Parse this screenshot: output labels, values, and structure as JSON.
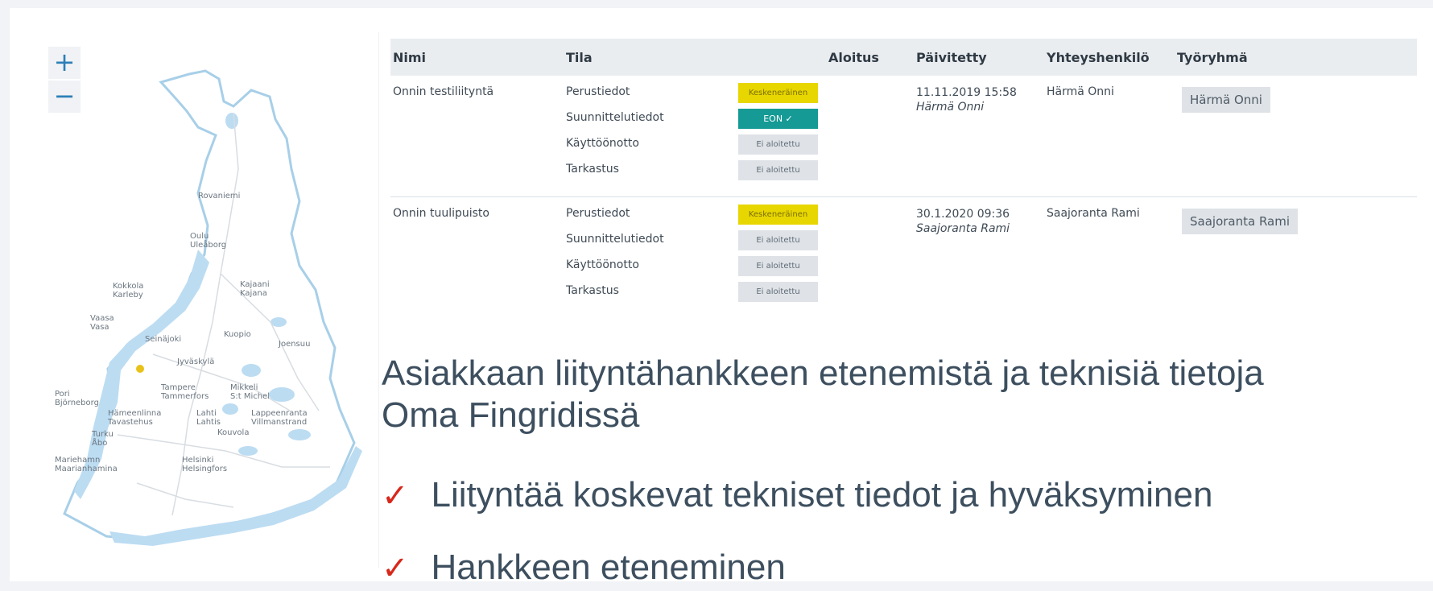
{
  "map": {
    "zoom_in": "+",
    "zoom_out": "−",
    "cities": [
      {
        "label": "Rovaniemi"
      },
      {
        "label": "Oulu\nUleåborg"
      },
      {
        "label": "Kokkola\nKarleby"
      },
      {
        "label": "Kajaani\nKajana"
      },
      {
        "label": "Vaasa\nVasa"
      },
      {
        "label": "Seinäjoki"
      },
      {
        "label": "Kuopio"
      },
      {
        "label": "Joensuu"
      },
      {
        "label": "Jyväskylä"
      },
      {
        "label": "Pori\nBjörneborg"
      },
      {
        "label": "Tampere\nTammerfors"
      },
      {
        "label": "Mikkeli\nS:t Michel"
      },
      {
        "label": "Hämeenlinna\nTavastehus"
      },
      {
        "label": "Lahti\nLahtis"
      },
      {
        "label": "Lappeenranta\nVillmanstrand"
      },
      {
        "label": "Kouvola"
      },
      {
        "label": "Turku\nÅbo"
      },
      {
        "label": "Mariehamn\nMaarianhamina"
      },
      {
        "label": "Helsinki\nHelsingfors"
      }
    ],
    "marker_color": "#e8c21a",
    "water_color": "#bcdcf2"
  },
  "table": {
    "headers": {
      "name": "Nimi",
      "status": "Tila",
      "start": "Aloitus",
      "updated": "Päivitetty",
      "contact": "Yhteyshenkilö",
      "workgroup": "Työryhmä"
    },
    "rows": [
      {
        "name": "Onnin testiliityntä",
        "phases": [
          {
            "label": "Perustiedot",
            "status": "Keskeneräinen"
          },
          {
            "label": "Suunnittelutiedot",
            "status": "EON ✓"
          },
          {
            "label": "Käyttöönotto",
            "status": "Ei aloitettu"
          },
          {
            "label": "Tarkastus",
            "status": "Ei aloitettu"
          }
        ],
        "updated_date": "11.11.2019 15:58",
        "updated_by": "Härmä Onni",
        "contact": "Härmä Onni",
        "workgroup": "Härmä Onni"
      },
      {
        "name": "Onnin tuulipuisto",
        "phases": [
          {
            "label": "Perustiedot",
            "status": "Keskeneräinen"
          },
          {
            "label": "Suunnittelutiedot",
            "status": "Ei aloitettu"
          },
          {
            "label": "Käyttöönotto",
            "status": "Ei aloitettu"
          },
          {
            "label": "Tarkastus",
            "status": "Ei aloitettu"
          }
        ],
        "updated_date": "30.1.2020 09:36",
        "updated_by": "Saajoranta Rami",
        "contact": "Saajoranta Rami",
        "workgroup": "Saajoranta Rami"
      }
    ],
    "status_colors": {
      "in_progress": "#e8d600",
      "approved": "#159a95",
      "not_started": "#dfe3e7"
    }
  },
  "overlay": {
    "headline_line1": "Asiakkaan liityntähankkeen etenemistä ja teknisiä tietoja",
    "headline_line2": "Oma Fingridissä",
    "check_glyph": "✓",
    "bullets": [
      "Liityntää koskevat tekniset tiedot ja hyväksyminen",
      "Hankkeen eteneminen"
    ],
    "check_color": "#d7281b"
  }
}
